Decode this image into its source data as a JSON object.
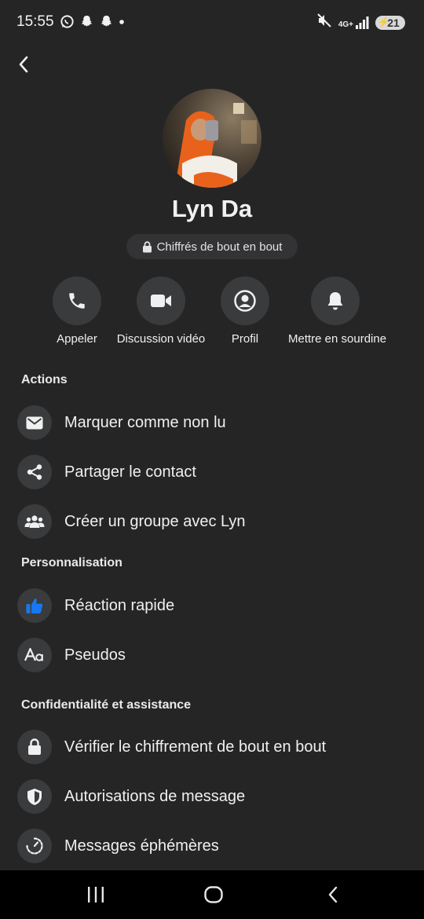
{
  "status": {
    "time": "15:55",
    "network": "4G+",
    "battery": "21"
  },
  "contact": {
    "name": "Lyn Da",
    "encryption_label": "Chiffrés de bout en bout"
  },
  "quick_actions": [
    {
      "label": "Appeler",
      "icon": "phone-icon"
    },
    {
      "label": "Discussion vidéo",
      "icon": "video-camera-icon"
    },
    {
      "label": "Profil",
      "icon": "profile-icon"
    },
    {
      "label": "Mettre en sourdine",
      "icon": "bell-icon"
    }
  ],
  "sections": {
    "actions": {
      "title": "Actions",
      "items": [
        {
          "label": "Marquer comme non lu",
          "icon": "envelope-icon"
        },
        {
          "label": "Partager le contact",
          "icon": "share-icon"
        },
        {
          "label": "Créer un groupe avec Lyn",
          "icon": "group-icon"
        }
      ]
    },
    "personalisation": {
      "title": "Personnalisation",
      "items": [
        {
          "label": "Réaction rapide",
          "icon": "thumbs-up-icon",
          "icon_color": "#1877f2"
        },
        {
          "label": "Pseudos",
          "icon": "font-aa-icon"
        }
      ]
    },
    "privacy": {
      "title": "Confidentialité et assistance",
      "items": [
        {
          "label": "Vérifier le chiffrement de bout en bout",
          "icon": "lock-icon"
        },
        {
          "label": "Autorisations de message",
          "icon": "shield-icon"
        },
        {
          "label": "Messages éphémères",
          "icon": "timer-icon"
        }
      ]
    }
  },
  "colors": {
    "background": "#252526",
    "icon_circle": "#3a3b3c",
    "accent": "#1877f2"
  }
}
